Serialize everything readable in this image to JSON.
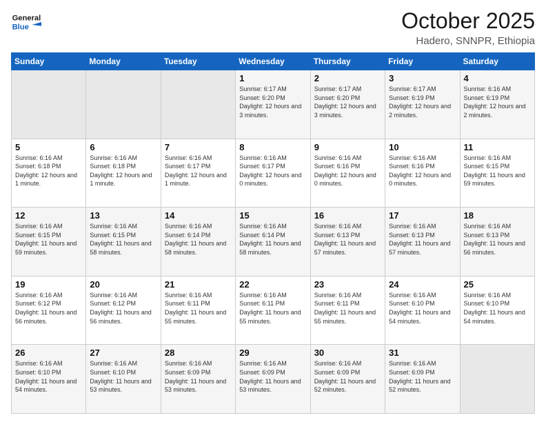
{
  "header": {
    "logo_general": "General",
    "logo_blue": "Blue",
    "month": "October 2025",
    "location": "Hadero, SNNPR, Ethiopia"
  },
  "weekdays": [
    "Sunday",
    "Monday",
    "Tuesday",
    "Wednesday",
    "Thursday",
    "Friday",
    "Saturday"
  ],
  "weeks": [
    [
      {
        "day": "",
        "info": ""
      },
      {
        "day": "",
        "info": ""
      },
      {
        "day": "",
        "info": ""
      },
      {
        "day": "1",
        "info": "Sunrise: 6:17 AM\nSunset: 6:20 PM\nDaylight: 12 hours and 3 minutes."
      },
      {
        "day": "2",
        "info": "Sunrise: 6:17 AM\nSunset: 6:20 PM\nDaylight: 12 hours and 3 minutes."
      },
      {
        "day": "3",
        "info": "Sunrise: 6:17 AM\nSunset: 6:19 PM\nDaylight: 12 hours and 2 minutes."
      },
      {
        "day": "4",
        "info": "Sunrise: 6:16 AM\nSunset: 6:19 PM\nDaylight: 12 hours and 2 minutes."
      }
    ],
    [
      {
        "day": "5",
        "info": "Sunrise: 6:16 AM\nSunset: 6:18 PM\nDaylight: 12 hours and 1 minute."
      },
      {
        "day": "6",
        "info": "Sunrise: 6:16 AM\nSunset: 6:18 PM\nDaylight: 12 hours and 1 minute."
      },
      {
        "day": "7",
        "info": "Sunrise: 6:16 AM\nSunset: 6:17 PM\nDaylight: 12 hours and 1 minute."
      },
      {
        "day": "8",
        "info": "Sunrise: 6:16 AM\nSunset: 6:17 PM\nDaylight: 12 hours and 0 minutes."
      },
      {
        "day": "9",
        "info": "Sunrise: 6:16 AM\nSunset: 6:16 PM\nDaylight: 12 hours and 0 minutes."
      },
      {
        "day": "10",
        "info": "Sunrise: 6:16 AM\nSunset: 6:16 PM\nDaylight: 12 hours and 0 minutes."
      },
      {
        "day": "11",
        "info": "Sunrise: 6:16 AM\nSunset: 6:15 PM\nDaylight: 11 hours and 59 minutes."
      }
    ],
    [
      {
        "day": "12",
        "info": "Sunrise: 6:16 AM\nSunset: 6:15 PM\nDaylight: 11 hours and 59 minutes."
      },
      {
        "day": "13",
        "info": "Sunrise: 6:16 AM\nSunset: 6:15 PM\nDaylight: 11 hours and 58 minutes."
      },
      {
        "day": "14",
        "info": "Sunrise: 6:16 AM\nSunset: 6:14 PM\nDaylight: 11 hours and 58 minutes."
      },
      {
        "day": "15",
        "info": "Sunrise: 6:16 AM\nSunset: 6:14 PM\nDaylight: 11 hours and 58 minutes."
      },
      {
        "day": "16",
        "info": "Sunrise: 6:16 AM\nSunset: 6:13 PM\nDaylight: 11 hours and 57 minutes."
      },
      {
        "day": "17",
        "info": "Sunrise: 6:16 AM\nSunset: 6:13 PM\nDaylight: 11 hours and 57 minutes."
      },
      {
        "day": "18",
        "info": "Sunrise: 6:16 AM\nSunset: 6:13 PM\nDaylight: 11 hours and 56 minutes."
      }
    ],
    [
      {
        "day": "19",
        "info": "Sunrise: 6:16 AM\nSunset: 6:12 PM\nDaylight: 11 hours and 56 minutes."
      },
      {
        "day": "20",
        "info": "Sunrise: 6:16 AM\nSunset: 6:12 PM\nDaylight: 11 hours and 56 minutes."
      },
      {
        "day": "21",
        "info": "Sunrise: 6:16 AM\nSunset: 6:11 PM\nDaylight: 11 hours and 55 minutes."
      },
      {
        "day": "22",
        "info": "Sunrise: 6:16 AM\nSunset: 6:11 PM\nDaylight: 11 hours and 55 minutes."
      },
      {
        "day": "23",
        "info": "Sunrise: 6:16 AM\nSunset: 6:11 PM\nDaylight: 11 hours and 55 minutes."
      },
      {
        "day": "24",
        "info": "Sunrise: 6:16 AM\nSunset: 6:10 PM\nDaylight: 11 hours and 54 minutes."
      },
      {
        "day": "25",
        "info": "Sunrise: 6:16 AM\nSunset: 6:10 PM\nDaylight: 11 hours and 54 minutes."
      }
    ],
    [
      {
        "day": "26",
        "info": "Sunrise: 6:16 AM\nSunset: 6:10 PM\nDaylight: 11 hours and 54 minutes."
      },
      {
        "day": "27",
        "info": "Sunrise: 6:16 AM\nSunset: 6:10 PM\nDaylight: 11 hours and 53 minutes."
      },
      {
        "day": "28",
        "info": "Sunrise: 6:16 AM\nSunset: 6:09 PM\nDaylight: 11 hours and 53 minutes."
      },
      {
        "day": "29",
        "info": "Sunrise: 6:16 AM\nSunset: 6:09 PM\nDaylight: 11 hours and 53 minutes."
      },
      {
        "day": "30",
        "info": "Sunrise: 6:16 AM\nSunset: 6:09 PM\nDaylight: 11 hours and 52 minutes."
      },
      {
        "day": "31",
        "info": "Sunrise: 6:16 AM\nSunset: 6:09 PM\nDaylight: 11 hours and 52 minutes."
      },
      {
        "day": "",
        "info": ""
      }
    ]
  ]
}
